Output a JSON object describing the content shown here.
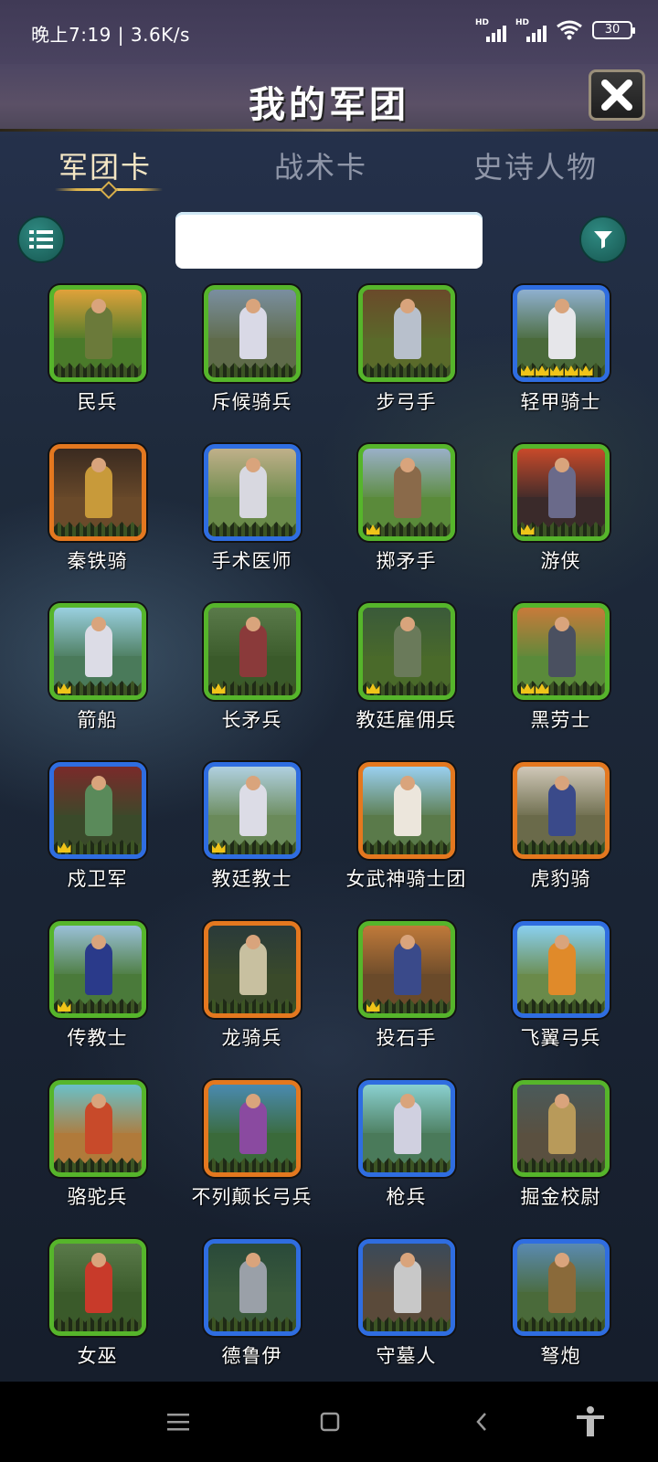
{
  "status_bar": {
    "time": "晚上7:19 | 3.6K/s",
    "signal_label_1": "HD",
    "signal_label_2": "HD",
    "battery": "30"
  },
  "header": {
    "title": "我的军团"
  },
  "tabs": [
    {
      "label": "军团卡",
      "active": true
    },
    {
      "label": "战术卡",
      "active": false
    },
    {
      "label": "史诗人物",
      "active": false
    }
  ],
  "search": {
    "value": "",
    "placeholder": ""
  },
  "units": [
    {
      "name": "民兵",
      "rarity": "green",
      "crowns": 0,
      "sky": "#e0a23a",
      "land": "#4a7a2a",
      "body": "#6b7a3a"
    },
    {
      "name": "斥候骑兵",
      "rarity": "green",
      "crowns": 0,
      "sky": "#7a8fa0",
      "land": "#5f6b4a",
      "body": "#d9d9e6"
    },
    {
      "name": "步弓手",
      "rarity": "green",
      "crowns": 0,
      "sky": "#6a4a2a",
      "land": "#5a6a2a",
      "body": "#b8c0cc"
    },
    {
      "name": "轻甲骑士",
      "rarity": "blue",
      "crowns": 5,
      "sky": "#8fb0d0",
      "land": "#4a6a3a",
      "body": "#e6e6ea"
    },
    {
      "name": "秦铁骑",
      "rarity": "orange",
      "crowns": 0,
      "sky": "#3a2a20",
      "land": "#6a4a2a",
      "body": "#c89a3a"
    },
    {
      "name": "手术医师",
      "rarity": "blue",
      "crowns": 0,
      "sky": "#c0b08a",
      "land": "#6a8a4a",
      "body": "#d8d8e0"
    },
    {
      "name": "掷矛手",
      "rarity": "green",
      "crowns": 1,
      "sky": "#9ab0c8",
      "land": "#5a8a3a",
      "body": "#8a6a4a"
    },
    {
      "name": "游侠",
      "rarity": "green",
      "crowns": 1,
      "sky": "#c84a2a",
      "land": "#3a2a2a",
      "body": "#6a6a8a"
    },
    {
      "name": "箭船",
      "rarity": "green",
      "crowns": 1,
      "sky": "#9ad0e0",
      "land": "#4a7a5a",
      "body": "#dcdce6"
    },
    {
      "name": "长矛兵",
      "rarity": "green",
      "crowns": 1,
      "sky": "#5a7a4a",
      "land": "#3a5a2a",
      "body": "#8a3a3a"
    },
    {
      "name": "教廷雇佣兵",
      "rarity": "green",
      "crowns": 1,
      "sky": "#3a5a3a",
      "land": "#4a6a2a",
      "body": "#6a7a5a"
    },
    {
      "name": "黑劳士",
      "rarity": "green",
      "crowns": 2,
      "sky": "#c87a3a",
      "land": "#5a8a3a",
      "body": "#4a5060"
    },
    {
      "name": "戍卫军",
      "rarity": "blue",
      "crowns": 1,
      "sky": "#7a2a2a",
      "land": "#3a4a2a",
      "body": "#5a8a5a"
    },
    {
      "name": "教廷教士",
      "rarity": "blue",
      "crowns": 1,
      "sky": "#b0d0e0",
      "land": "#6a8a5a",
      "body": "#dcdce6"
    },
    {
      "name": "女武神骑士团",
      "rarity": "orange",
      "crowns": 0,
      "sky": "#9ad0f0",
      "land": "#5a7a4a",
      "body": "#ece6dc"
    },
    {
      "name": "虎豹骑",
      "rarity": "orange",
      "crowns": 0,
      "sky": "#d0c8b8",
      "land": "#6a6a4a",
      "body": "#3a4a8a"
    },
    {
      "name": "传教士",
      "rarity": "green",
      "crowns": 1,
      "sky": "#9ac0d8",
      "land": "#4a7a3a",
      "body": "#2a3a8a"
    },
    {
      "name": "龙骑兵",
      "rarity": "orange",
      "crowns": 0,
      "sky": "#2a3a3a",
      "land": "#3a4a2a",
      "body": "#c8c0a0"
    },
    {
      "name": "投石手",
      "rarity": "green",
      "crowns": 1,
      "sky": "#c07a3a",
      "land": "#6a4a2a",
      "body": "#3a4a8a"
    },
    {
      "name": "飞翼弓兵",
      "rarity": "blue",
      "crowns": 0,
      "sky": "#8ad0f0",
      "land": "#6a8a4a",
      "body": "#e08a2a"
    },
    {
      "name": "骆驼兵",
      "rarity": "green",
      "crowns": 0,
      "sky": "#6ac0c8",
      "land": "#b07a3a",
      "body": "#c84a2a"
    },
    {
      "name": "不列颠长弓兵",
      "rarity": "orange",
      "crowns": 0,
      "sky": "#4a8ab0",
      "land": "#3a6a3a",
      "body": "#8a4aa0"
    },
    {
      "name": "枪兵",
      "rarity": "blue",
      "crowns": 0,
      "sky": "#8ad0d0",
      "land": "#4a7a5a",
      "body": "#d0d0e0"
    },
    {
      "name": "掘金校尉",
      "rarity": "green",
      "crowns": 0,
      "sky": "#4a5a5a",
      "land": "#5a5040",
      "body": "#b89a5a"
    },
    {
      "name": "女巫",
      "rarity": "green",
      "crowns": 0,
      "sky": "#5a7a4a",
      "land": "#3a5a2a",
      "body": "#c83a2a"
    },
    {
      "name": "德鲁伊",
      "rarity": "blue",
      "crowns": 0,
      "sky": "#2a4a3a",
      "land": "#3a5a3a",
      "body": "#9aa0a8"
    },
    {
      "name": "守墓人",
      "rarity": "blue",
      "crowns": 0,
      "sky": "#3a4a5a",
      "land": "#5a4a3a",
      "body": "#c8c8c8"
    },
    {
      "name": "弩炮",
      "rarity": "blue",
      "crowns": 0,
      "sky": "#5a8ab0",
      "land": "#4a6a3a",
      "body": "#8a6a3a"
    }
  ],
  "bottom_nav": {
    "items": [
      "menu-icon",
      "home-icon",
      "back-icon",
      "accessibility-icon"
    ]
  }
}
